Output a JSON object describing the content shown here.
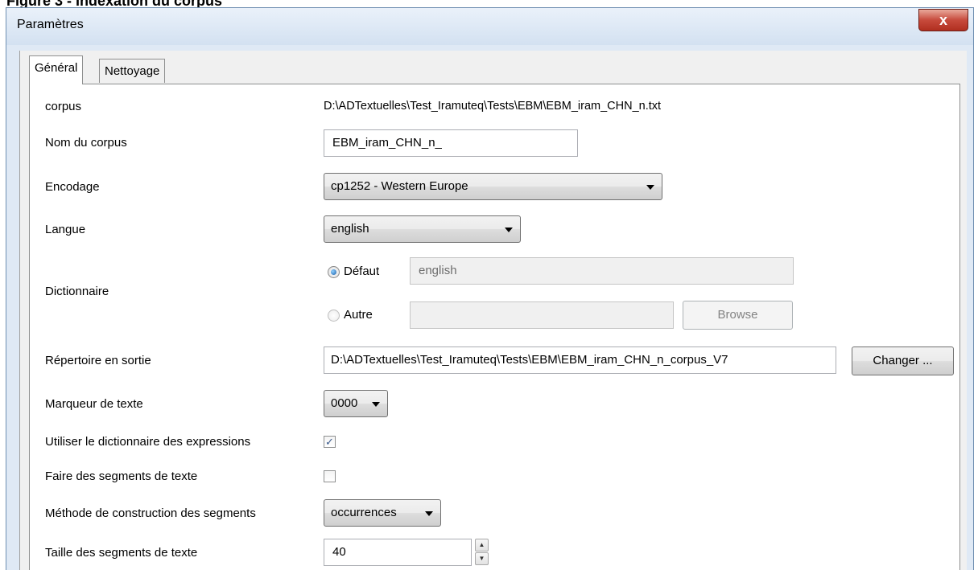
{
  "document": {
    "caption": "Figure 3 - Indexation du corpus"
  },
  "window": {
    "title": "Paramètres",
    "close_glyph": "x"
  },
  "tabs": [
    {
      "label": "Général",
      "active": true
    },
    {
      "label": "Nettoyage",
      "active": false
    }
  ],
  "form": {
    "corpus": {
      "label": "corpus",
      "value": "D:\\ADTextuelles\\Test_Iramuteq\\Tests\\EBM\\EBM_iram_CHN_n.txt"
    },
    "nom_corpus": {
      "label": "Nom du corpus",
      "value": "EBM_iram_CHN_n_"
    },
    "encodage": {
      "label": "Encodage",
      "value": "cp1252 - Western Europe"
    },
    "langue": {
      "label": "Langue",
      "value": "english"
    },
    "dictionnaire": {
      "label": "Dictionnaire",
      "default_option": "Défaut",
      "default_value": "english",
      "other_option": "Autre",
      "other_value": "",
      "browse_label": "Browse",
      "selected": "Défaut"
    },
    "repertoire": {
      "label": "Répertoire en sortie",
      "value": "D:\\ADTextuelles\\Test_Iramuteq\\Tests\\EBM\\EBM_iram_CHN_n_corpus_V7",
      "button": "Changer ..."
    },
    "marqueur": {
      "label": "Marqueur de texte",
      "value": "0000"
    },
    "expressions": {
      "label": "Utiliser le dictionnaire des expressions",
      "checked": true
    },
    "segments": {
      "label": "Faire des segments de texte",
      "checked": false
    },
    "methode": {
      "label": "Méthode de construction des segments",
      "value": "occurrences"
    },
    "taille": {
      "label": "Taille des segments de texte",
      "value": "40"
    }
  },
  "colors": {
    "titlebar": "#dfe9f5",
    "close_button": "#c74a3c",
    "panel": "#ffffff"
  }
}
